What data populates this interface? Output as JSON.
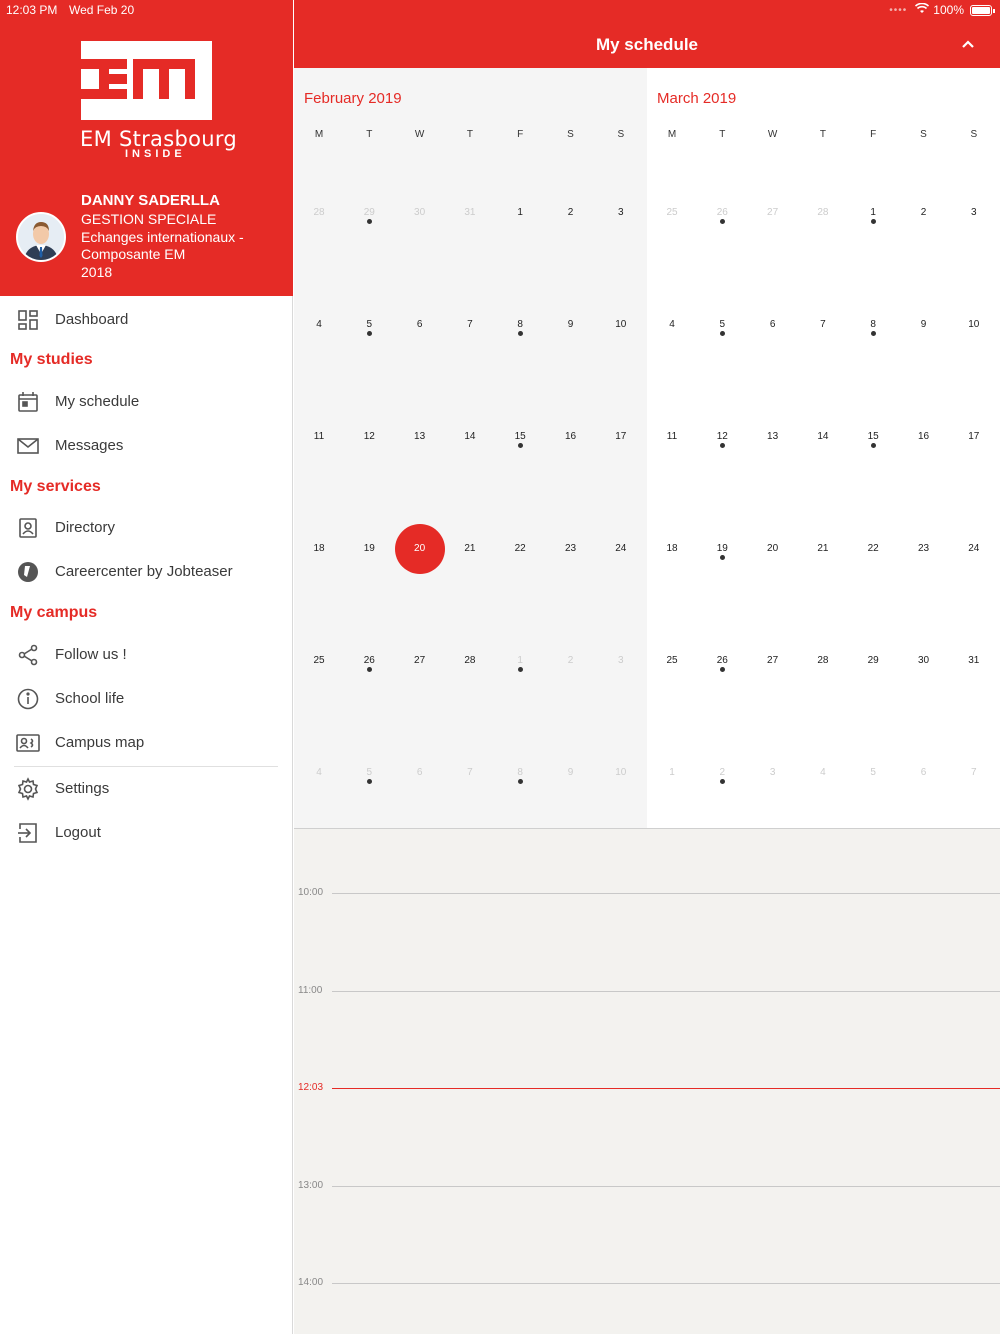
{
  "status_bar": {
    "time": "12:03 PM",
    "date": "Wed Feb 20",
    "battery": "100%"
  },
  "brand": {
    "logo_text": "EM Strasbourg",
    "logo_sub": "INSIDE",
    "accent": "#e52b26"
  },
  "user": {
    "name": "DANNY SADERLLA",
    "line1": "GESTION SPECIALE",
    "line2": "Echanges internationaux -",
    "line3": "Composante EM",
    "line4": "2018"
  },
  "nav": {
    "dashboard": "Dashboard",
    "sec_studies": "My studies",
    "my_schedule": "My schedule",
    "messages": "Messages",
    "sec_services": "My services",
    "directory": "Directory",
    "careercenter": "Careercenter by Jobteaser",
    "sec_campus": "My campus",
    "follow_us": "Follow us !",
    "school_life": "School life",
    "campus_map": "Campus map",
    "settings": "Settings",
    "logout": "Logout"
  },
  "header": {
    "title": "My schedule"
  },
  "calendar": {
    "weekdays": [
      "M",
      "T",
      "W",
      "T",
      "F",
      "S",
      "S"
    ],
    "months": [
      {
        "title": "February 2019",
        "weeks": [
          [
            {
              "d": "28",
              "dim": true
            },
            {
              "d": "29",
              "dim": true,
              "ev": true
            },
            {
              "d": "30",
              "dim": true
            },
            {
              "d": "31",
              "dim": true
            },
            {
              "d": "1"
            },
            {
              "d": "2"
            },
            {
              "d": "3"
            }
          ],
          [
            {
              "d": "4"
            },
            {
              "d": "5",
              "ev": true
            },
            {
              "d": "6"
            },
            {
              "d": "7"
            },
            {
              "d": "8",
              "ev": true
            },
            {
              "d": "9"
            },
            {
              "d": "10"
            }
          ],
          [
            {
              "d": "11"
            },
            {
              "d": "12"
            },
            {
              "d": "13"
            },
            {
              "d": "14"
            },
            {
              "d": "15",
              "ev": true
            },
            {
              "d": "16"
            },
            {
              "d": "17"
            }
          ],
          [
            {
              "d": "18"
            },
            {
              "d": "19"
            },
            {
              "d": "20",
              "today": true
            },
            {
              "d": "21"
            },
            {
              "d": "22"
            },
            {
              "d": "23"
            },
            {
              "d": "24"
            }
          ],
          [
            {
              "d": "25"
            },
            {
              "d": "26",
              "ev": true
            },
            {
              "d": "27"
            },
            {
              "d": "28"
            },
            {
              "d": "1",
              "dim": true,
              "ev": true
            },
            {
              "d": "2",
              "dim": true
            },
            {
              "d": "3",
              "dim": true
            }
          ],
          [
            {
              "d": "4",
              "dim": true
            },
            {
              "d": "5",
              "dim": true,
              "ev": true
            },
            {
              "d": "6",
              "dim": true
            },
            {
              "d": "7",
              "dim": true
            },
            {
              "d": "8",
              "dim": true,
              "ev": true
            },
            {
              "d": "9",
              "dim": true
            },
            {
              "d": "10",
              "dim": true
            }
          ]
        ]
      },
      {
        "title": "March 2019",
        "weeks": [
          [
            {
              "d": "25",
              "dim": true
            },
            {
              "d": "26",
              "dim": true,
              "ev": true
            },
            {
              "d": "27",
              "dim": true
            },
            {
              "d": "28",
              "dim": true
            },
            {
              "d": "1",
              "ev": true
            },
            {
              "d": "2"
            },
            {
              "d": "3"
            }
          ],
          [
            {
              "d": "4"
            },
            {
              "d": "5",
              "ev": true
            },
            {
              "d": "6"
            },
            {
              "d": "7"
            },
            {
              "d": "8",
              "ev": true
            },
            {
              "d": "9"
            },
            {
              "d": "10"
            }
          ],
          [
            {
              "d": "11"
            },
            {
              "d": "12",
              "ev": true
            },
            {
              "d": "13"
            },
            {
              "d": "14"
            },
            {
              "d": "15",
              "ev": true
            },
            {
              "d": "16"
            },
            {
              "d": "17"
            }
          ],
          [
            {
              "d": "18"
            },
            {
              "d": "19",
              "ev": true
            },
            {
              "d": "20"
            },
            {
              "d": "21"
            },
            {
              "d": "22"
            },
            {
              "d": "23"
            },
            {
              "d": "24"
            }
          ],
          [
            {
              "d": "25"
            },
            {
              "d": "26",
              "ev": true
            },
            {
              "d": "27"
            },
            {
              "d": "28"
            },
            {
              "d": "29"
            },
            {
              "d": "30"
            },
            {
              "d": "31"
            }
          ],
          [
            {
              "d": "1",
              "dim": true
            },
            {
              "d": "2",
              "dim": true,
              "ev": true
            },
            {
              "d": "3",
              "dim": true
            },
            {
              "d": "4",
              "dim": true
            },
            {
              "d": "5",
              "dim": true
            },
            {
              "d": "6",
              "dim": true
            },
            {
              "d": "7",
              "dim": true
            }
          ]
        ]
      }
    ]
  },
  "timeline": {
    "hours": [
      {
        "label": "10:00",
        "now": false
      },
      {
        "label": "11:00",
        "now": false
      },
      {
        "label": "12:03",
        "now": true
      },
      {
        "label": "13:00",
        "now": false
      },
      {
        "label": "14:00",
        "now": false
      }
    ]
  }
}
